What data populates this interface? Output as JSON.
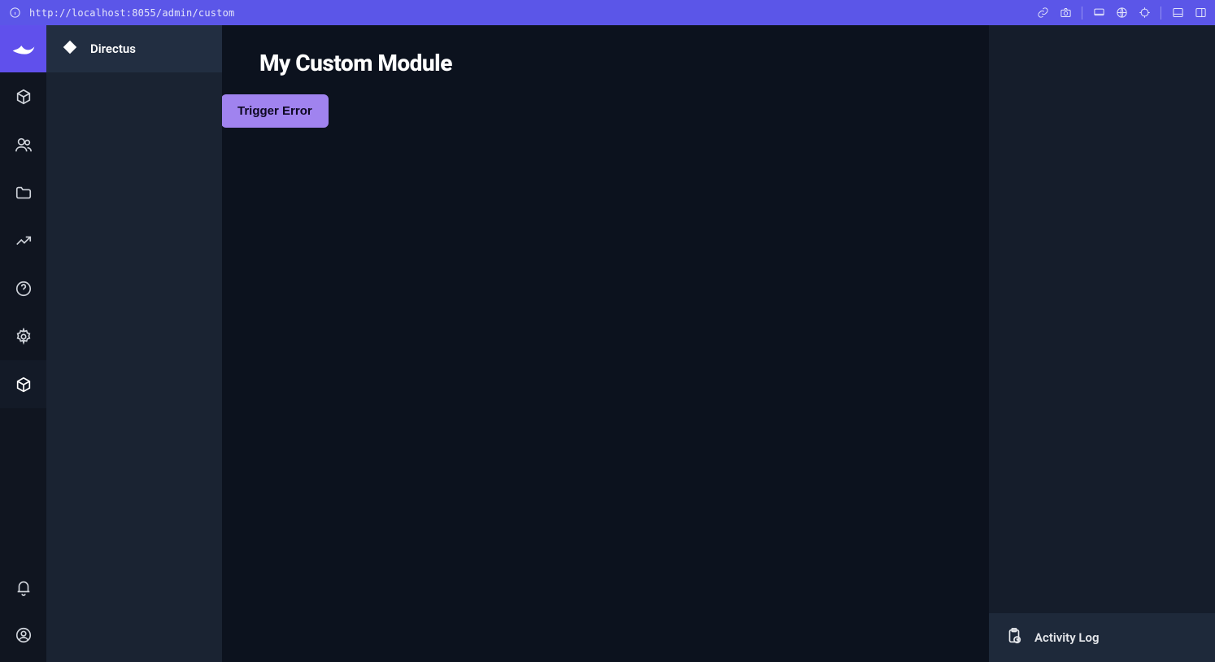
{
  "topbar": {
    "url": "http://localhost:8055/admin/custom"
  },
  "sidebar": {
    "title": "Directus"
  },
  "main": {
    "heading": "My Custom Module",
    "button_label": "Trigger Error"
  },
  "rightpanel": {
    "footer_label": "Activity Log"
  }
}
